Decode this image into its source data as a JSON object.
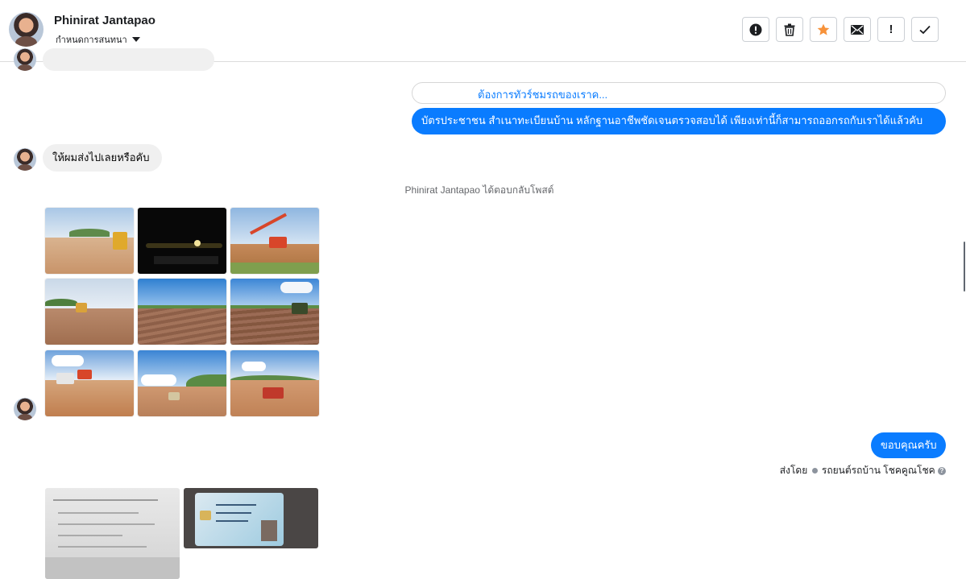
{
  "header": {
    "name": "Phinirat Jantapao",
    "subtitle": "กำหนดการสนทนา"
  },
  "toolbar": {
    "report_icon": "exclamation-circle-icon",
    "delete_icon": "trash-icon",
    "star_icon": "star-icon",
    "mail_icon": "envelope-icon",
    "important_label": "!",
    "done_icon": "check-icon",
    "star_color": "#f7923a"
  },
  "messages": {
    "reply_preview": "ต้องการทัวร์ชมรถของเราค...",
    "outgoing_1": "บัตรประชาชน สำเนาทะเบียนบ้าน หลักฐานอาชีพชัดเจนตรวจสอบได้ เพียงเท่านี้ก็สามารถออกรถกับเราได้แล้วคับ",
    "incoming_1": "ให้ผมส่งไปเลยหรือคับ",
    "system_note": "Phinirat Jantapao ได้ตอบกลับโพสต์",
    "outgoing_2": "ขอบคุณครับ",
    "sent_by_prefix": "ส่งโดย",
    "sent_by_name": "รถยนต์รถบ้าน โชคคูณโชค",
    "help_label": "?"
  },
  "colors": {
    "accent": "#0a7cff",
    "incoming_bubble": "#f0f0f0"
  }
}
